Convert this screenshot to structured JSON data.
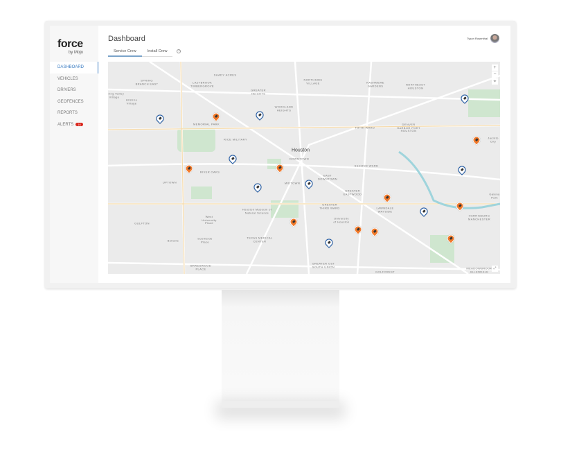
{
  "app": {
    "logo": "force",
    "logo_sub": "by Mojo"
  },
  "sidebar": {
    "items": [
      {
        "label": "DASHBOARD",
        "active": true
      },
      {
        "label": "VEHICLES"
      },
      {
        "label": "DRIVERS"
      },
      {
        "label": "GEOFENCES"
      },
      {
        "label": "REPORTS"
      },
      {
        "label": "ALERTS",
        "badge": "16"
      }
    ]
  },
  "header": {
    "title": "Dashboard",
    "user": "Tyson Rosenthal"
  },
  "tabs": [
    {
      "label": "Service Crew",
      "active": true
    },
    {
      "label": "Install Crew"
    }
  ],
  "map": {
    "zoom_in": "+",
    "zoom_out": "−",
    "labels": [
      "SPRING\nBRANCH EAST",
      "LAZYBROOK\nTIMBERGROVE",
      "SHADY ACRES",
      "GREATER\nHEIGHTS",
      "NORTHSIDE\nVILLAGE",
      "KASHMERE\nGARDENS",
      "NORTHEAST\nHOUSTON",
      "Spring Valley\nVillage",
      "Hilshire\nVillage",
      "WOODLAND\nHEIGHTS",
      "MEMORIAL PARK",
      "RICE MILITARY",
      "FIFTH WARD",
      "DENVER\nHARBOR PORT\nHOUSTON",
      "Jacinto City",
      "Houston",
      "DOWNTOWN",
      "SECOND WARD",
      "RIVER OAKS",
      "UPTOWN",
      "EAST\nDOWNTOWN",
      "MIDTOWN",
      "GREATER\nEASTWOOD",
      "GREATER\nTHIRD WARD",
      "LAWNDALE\nWAYSIDE",
      "Galena\nPark",
      "HARRISBURG\nMANCHESTER",
      "GULFTON",
      "West\nUniversity\nPlace",
      "University\nof Houston",
      "Houston Museum of\nNatural Science",
      "Bellaire",
      "Southside\nPlace",
      "TEXAS MEDICAL\nCENTER",
      "BRAESWOOD\nPLACE",
      "GREATER OST\nSOUTH UNION",
      "GOLFCREST",
      "MEADOWBROOK\nALLENDALE"
    ],
    "pins": [
      "orange",
      "orange",
      "orange",
      "orange",
      "orange",
      "orange",
      "orange",
      "orange",
      "orange",
      "orange",
      "blue",
      "blue",
      "blue",
      "blue",
      "blue",
      "blue",
      "blue",
      "blue",
      "blue"
    ]
  },
  "colors": {
    "accent": "#3a7cc2",
    "pin_orange": "#f07a2c",
    "pin_blue": "#1e5aa8",
    "alert": "#d9261c"
  }
}
